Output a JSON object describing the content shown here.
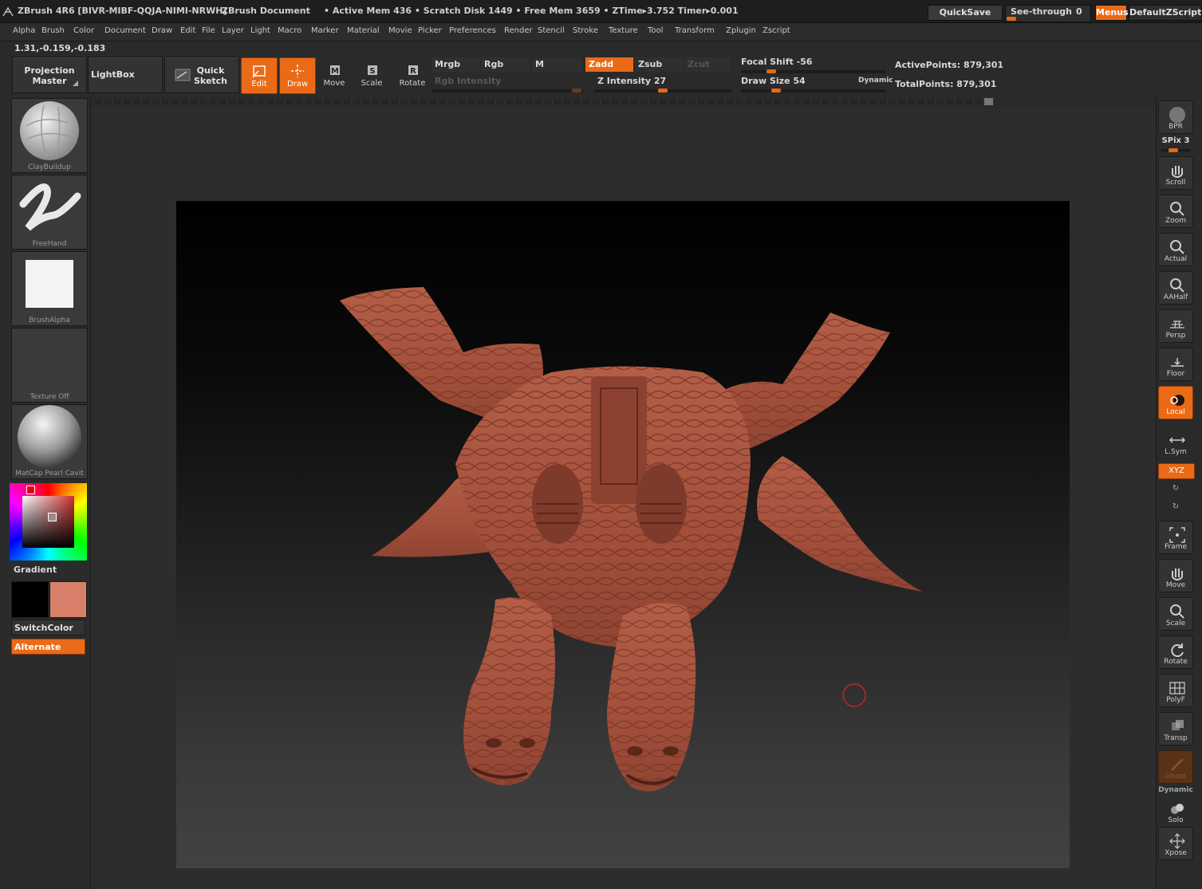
{
  "titlebar": {
    "app": "ZBrush 4R6 [BIVR-MIBF-QQJA-NIMI-NRWH]",
    "document": "ZBrush Document",
    "stats": "• Active Mem 436 • Scratch Disk 1449 • Free Mem 3659 • ZTime▸3.752 Timer▸0.001",
    "quicksave": "QuickSave",
    "seethrough": "See-through",
    "seethrough_value": "0",
    "menus": "Menus",
    "zscript": "DefaultZScript"
  },
  "menubar": [
    "Alpha",
    "Brush",
    "Color",
    "Document",
    "Draw",
    "Edit",
    "File",
    "Layer",
    "Light",
    "Macro",
    "Marker",
    "Material",
    "Movie",
    "Picker",
    "Preferences",
    "Render",
    "Stencil",
    "Stroke",
    "Texture",
    "Tool",
    "Transform",
    "Zplugin",
    "Zscript"
  ],
  "coords": "1.31,-0.159,-0.183",
  "toolbar": {
    "projection_master": "Projection Master",
    "projection_line1": "Projection",
    "projection_line2": "Master",
    "lightbox": "LightBox",
    "quick_sketch_line1": "Quick",
    "quick_sketch_line2": "Sketch",
    "edit": "Edit",
    "draw": "Draw",
    "move": "Move",
    "scale": "Scale",
    "rotate": "Rotate",
    "mrgb": "Mrgb",
    "rgb": "Rgb",
    "m": "M",
    "zadd": "Zadd",
    "zsub": "Zsub",
    "zcut": "Zcut",
    "rgb_intensity": "Rgb Intensity",
    "z_intensity": "Z Intensity 27",
    "z_intensity_value": 27,
    "focal_shift": "Focal Shift -56",
    "focal_shift_value": -56,
    "draw_size": "Draw Size 54",
    "draw_size_value": 54,
    "dynamic": "Dynamic",
    "active_points": "ActivePoints: 879,301",
    "total_points": "TotalPoints: 879,301"
  },
  "leftpanel": {
    "brush": "ClayBuildup",
    "stroke": "FreeHand",
    "alpha": "BrushAlpha",
    "texture": "Texture Off",
    "material": "MatCap Pearl Cavit",
    "gradient": "Gradient",
    "switchcolor": "SwitchColor",
    "alternate": "Alternate",
    "main_color": "#000000",
    "secondary_color": "#d9806a"
  },
  "rightpanel": {
    "bpr": "BPR",
    "spix": "SPix 3",
    "scroll": "Scroll",
    "zoom": "Zoom",
    "actual": "Actual",
    "aahalf": "AAHalf",
    "persp": "Persp",
    "floor": "Floor",
    "local": "Local",
    "lsym": "L.Sym",
    "xyz": "XYZ",
    "frame": "Frame",
    "move": "Move",
    "scale": "Scale",
    "rotate": "Rotate",
    "polyf": "PolyF",
    "transp": "Transp",
    "ghost": "Ghost",
    "dynamic": "Dynamic",
    "solo": "Solo",
    "xpose": "Xpose"
  },
  "colors": {
    "accent": "#ea6a17",
    "model": "#b8624a",
    "background": "#2a2a2a"
  }
}
